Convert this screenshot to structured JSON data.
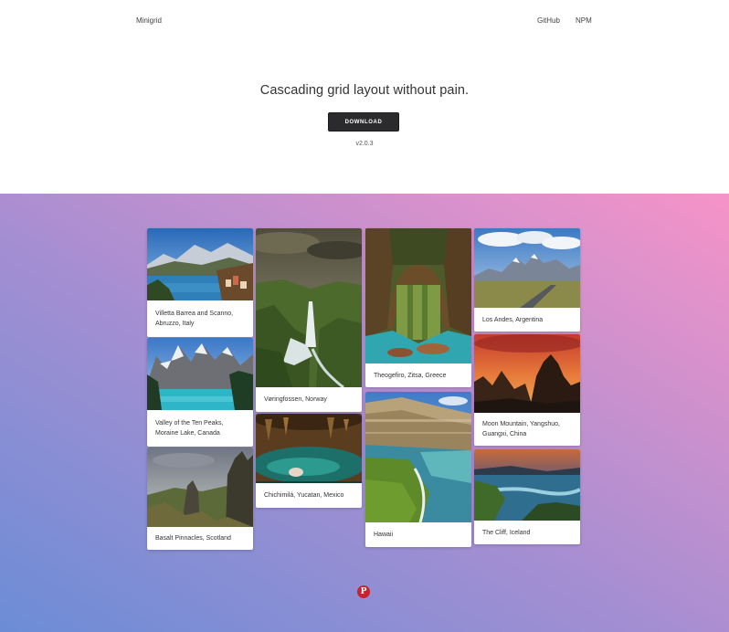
{
  "header": {
    "brand": "Minigrid",
    "nav": [
      {
        "label": "GitHub"
      },
      {
        "label": "NPM"
      }
    ]
  },
  "hero": {
    "tagline": "Cascading grid layout without pain.",
    "download_label": "DOWNLOAD",
    "version": "v2.0.3"
  },
  "grid": {
    "cards": [
      {
        "caption": "Villetta Barrea and Scanno, Abruzzo, Italy"
      },
      {
        "caption": "Valley of the Ten Peaks, Moraine Lake, Canada"
      },
      {
        "caption": "Basalt Pinnacles, Scotland"
      },
      {
        "caption": "Vøringfossen, Norway"
      },
      {
        "caption": "Chichimilá, Yucatan, Mexico"
      },
      {
        "caption": "Theogefiro, Zitsa, Greece"
      },
      {
        "caption": "Hawaii"
      },
      {
        "caption": "Los Andes, Argentina"
      },
      {
        "caption": "Moon Mountain, Yangshuo, Guangxi, China"
      },
      {
        "caption": "The Cliff, Iceland"
      }
    ]
  },
  "footer": {
    "pinterest_icon": "pinterest-icon",
    "pinterest_glyph": "P"
  },
  "colors": {
    "gradient_start": "#6b8dd6",
    "gradient_mid": "#a48ed2",
    "gradient_end": "#f693c8",
    "button": "#2b2b2d",
    "pinterest": "#c8232c"
  }
}
